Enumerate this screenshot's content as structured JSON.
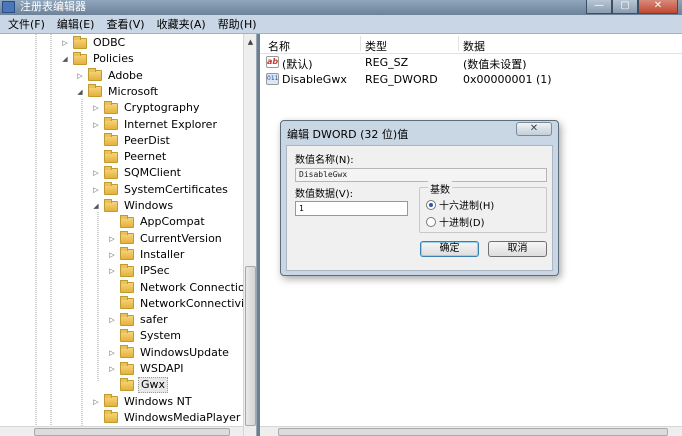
{
  "window": {
    "title": "注册表编辑器",
    "controls": [
      "—",
      "▢",
      "✕"
    ]
  },
  "menu": [
    "文件(F)",
    "编辑(E)",
    "查看(V)",
    "收藏夹(A)",
    "帮助(H)"
  ],
  "tree": [
    {
      "label": "ODBC",
      "indent": 0,
      "expander": "▷"
    },
    {
      "label": "Policies",
      "indent": 0,
      "expander": "◢"
    },
    {
      "label": "Adobe",
      "indent": 1,
      "expander": "▷"
    },
    {
      "label": "Microsoft",
      "indent": 1,
      "expander": "◢"
    },
    {
      "label": "Cryptography",
      "indent": 2,
      "expander": "▷"
    },
    {
      "label": "Internet Explorer",
      "indent": 2,
      "expander": "▷"
    },
    {
      "label": "PeerDist",
      "indent": 2,
      "expander": ""
    },
    {
      "label": "Peernet",
      "indent": 2,
      "expander": ""
    },
    {
      "label": "SQMClient",
      "indent": 2,
      "expander": "▷"
    },
    {
      "label": "SystemCertificates",
      "indent": 2,
      "expander": "▷"
    },
    {
      "label": "Windows",
      "indent": 2,
      "expander": "◢"
    },
    {
      "label": "AppCompat",
      "indent": 3,
      "expander": ""
    },
    {
      "label": "CurrentVersion",
      "indent": 3,
      "expander": "▷"
    },
    {
      "label": "Installer",
      "indent": 3,
      "expander": "▷"
    },
    {
      "label": "IPSec",
      "indent": 3,
      "expander": "▷"
    },
    {
      "label": "Network Connections",
      "indent": 3,
      "expander": ""
    },
    {
      "label": "NetworkConnectivitySta",
      "indent": 3,
      "expander": ""
    },
    {
      "label": "safer",
      "indent": 3,
      "expander": "▷"
    },
    {
      "label": "System",
      "indent": 3,
      "expander": ""
    },
    {
      "label": "WindowsUpdate",
      "indent": 3,
      "expander": "▷"
    },
    {
      "label": "WSDAPI",
      "indent": 3,
      "expander": "▷"
    },
    {
      "label": "Gwx",
      "indent": 3,
      "expander": "",
      "selected": true
    },
    {
      "label": "Windows NT",
      "indent": 2,
      "expander": "▷"
    },
    {
      "label": "WindowsMediaPlayer",
      "indent": 2,
      "expander": ""
    }
  ],
  "list": {
    "columns": [
      "名称",
      "类型",
      "数据"
    ],
    "rows": [
      {
        "icon": "string-value-icon",
        "icon_text": "ab",
        "name": "(默认)",
        "type": "REG_SZ",
        "data": "(数值未设置)"
      },
      {
        "icon": "binary-value-icon",
        "icon_text": "011",
        "name": "DisableGwx",
        "type": "REG_DWORD",
        "data": "0x00000001 (1)"
      }
    ]
  },
  "dialog": {
    "title": "编辑 DWORD (32 位)值",
    "close": "✕",
    "name_label": "数值名称(N):",
    "name_value": "DisableGwx",
    "data_label": "数值数据(V):",
    "data_value": "1",
    "base_label": "基数",
    "radio_hex": "十六进制(H)",
    "radio_dec": "十进制(D)",
    "ok": "确定",
    "cancel": "取消"
  }
}
